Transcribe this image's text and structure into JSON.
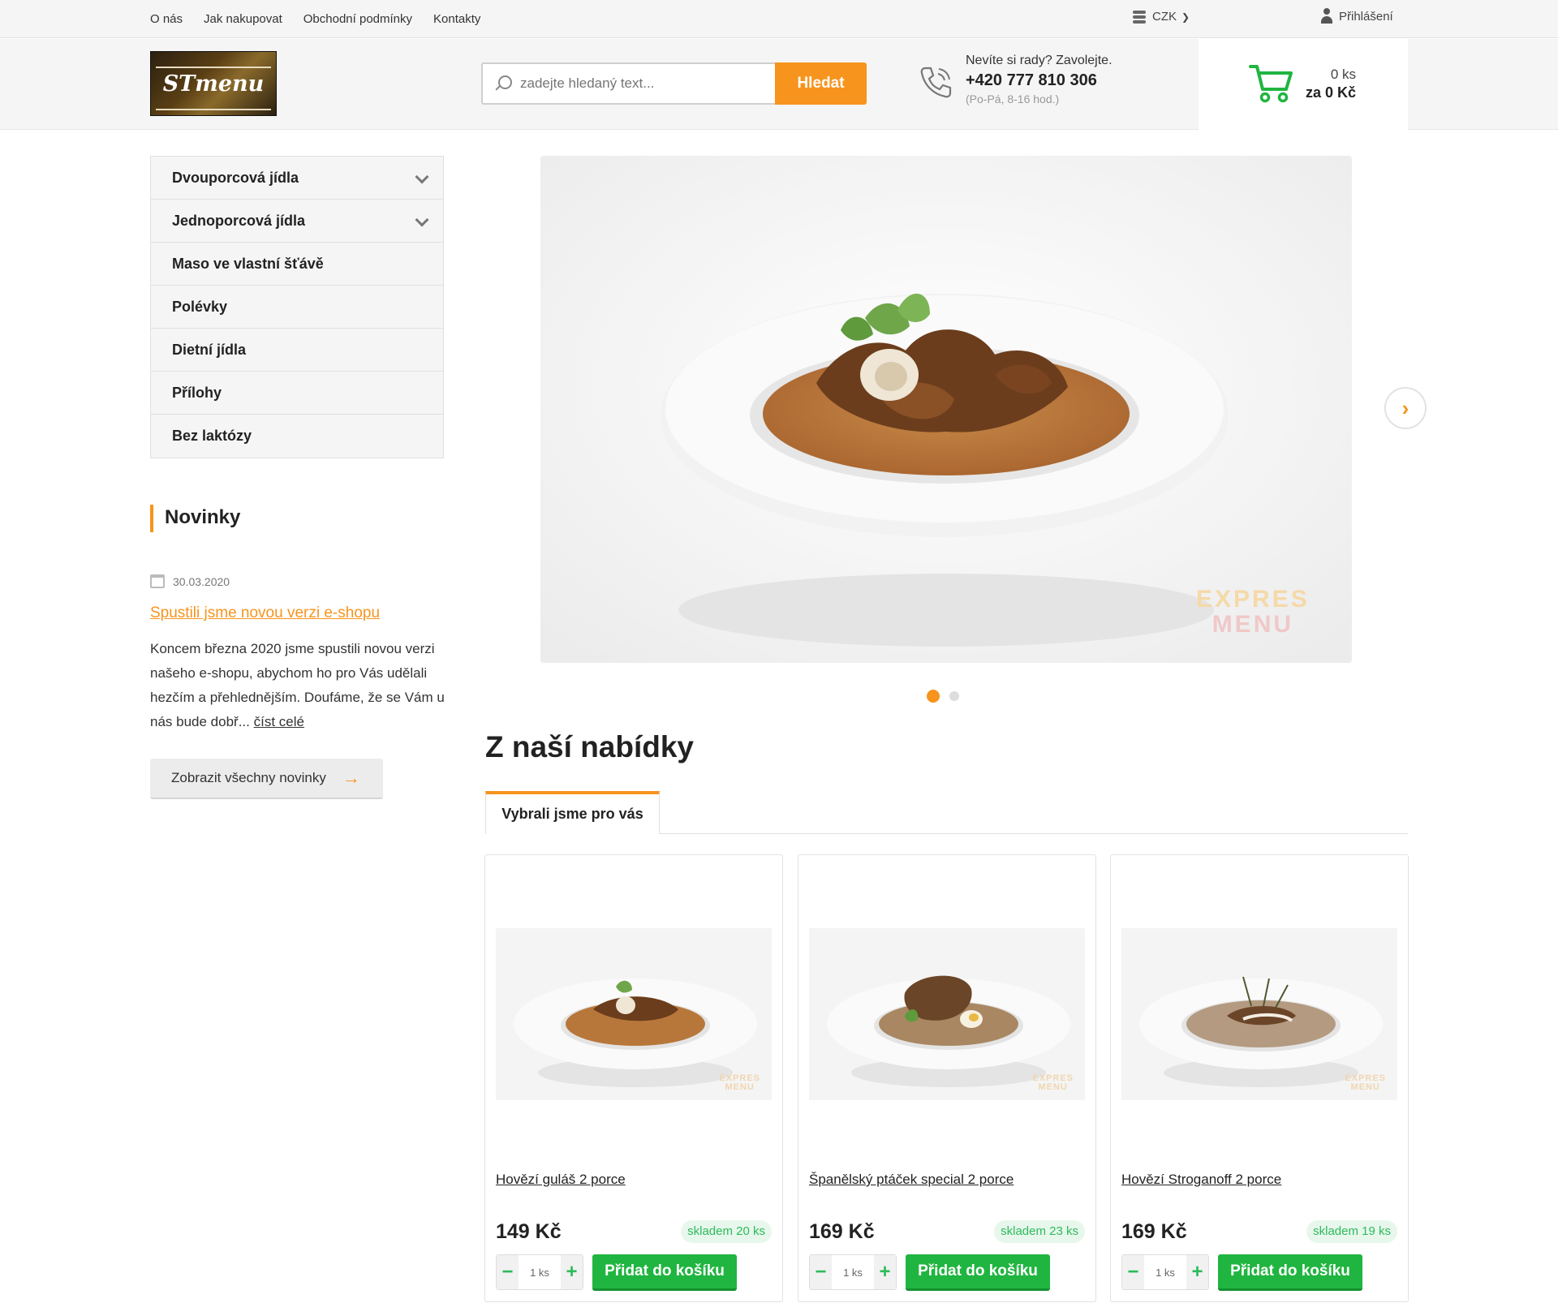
{
  "topnav": {
    "links": [
      "O nás",
      "Jak nakupovat",
      "Obchodní podmínky",
      "Kontakty"
    ],
    "currency": "CZK",
    "login": "Přihlášení"
  },
  "header": {
    "logo_text": "STmenu",
    "search": {
      "placeholder": "zadejte hledaný text...",
      "button": "Hledat"
    },
    "contact": {
      "question": "Nevíte si rady? Zavolejte.",
      "phone": "+420 777 810 306",
      "hours": "(Po-Pá, 8-16 hod.)"
    },
    "cart": {
      "count": "0 ks",
      "total": "za 0 Kč"
    }
  },
  "sidebar": {
    "categories": [
      {
        "label": "Dvouporcová jídla",
        "has_submenu": true
      },
      {
        "label": "Jednoporcová jídla",
        "has_submenu": true
      },
      {
        "label": "Maso ve vlastní šťávě",
        "has_submenu": false
      },
      {
        "label": "Polévky",
        "has_submenu": false
      },
      {
        "label": "Dietní jídla",
        "has_submenu": false
      },
      {
        "label": "Přílohy",
        "has_submenu": false
      },
      {
        "label": "Bez laktózy",
        "has_submenu": false
      }
    ],
    "news": {
      "heading": "Novinky",
      "date": "30.03.2020",
      "title": "Spustili jsme novou verzi e-shopu",
      "text": "Koncem března 2020 jsme spustili novou verzi našeho e-shopu, abychom ho pro Vás udělali hezčím a přehlednějším. Doufáme, že se Vám u nás bude dobř...",
      "read_more": "číst celé",
      "all_button": "Zobrazit všechny novinky"
    }
  },
  "slider": {
    "watermark_line1": "EXPRES",
    "watermark_line2": "MENU",
    "active_slide": 1,
    "slide_count": 2
  },
  "offer": {
    "title": "Z naší nabídky",
    "tab": "Vybrali jsme pro vás"
  },
  "products": [
    {
      "name": "Hovězí guláš 2 porce",
      "price": "149 Kč",
      "stock": "skladem 20 ks",
      "qty": "1 ks",
      "add": "Přidat do košíku"
    },
    {
      "name": "Španělský ptáček special 2 porce",
      "price": "169 Kč",
      "stock": "skladem 23 ks",
      "qty": "1 ks",
      "add": "Přidat do košíku"
    },
    {
      "name": "Hovězí Stroganoff 2 porce",
      "price": "169 Kč",
      "stock": "skladem 19 ks",
      "qty": "1 ks",
      "add": "Přidat do košíku"
    }
  ],
  "colors": {
    "accent": "#f7941d",
    "green": "#20b540"
  }
}
